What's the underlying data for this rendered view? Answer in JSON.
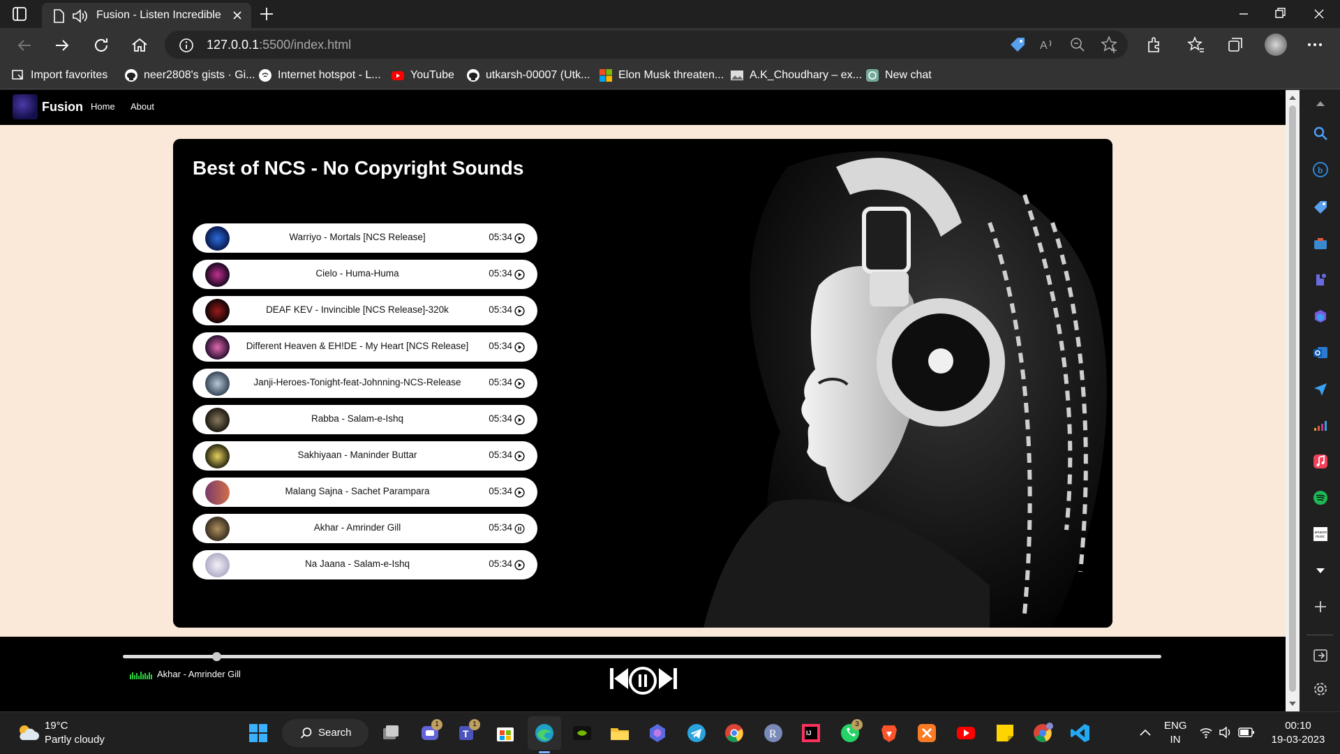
{
  "browser": {
    "tab": {
      "title": "Fusion - Listen Incredible"
    },
    "address": {
      "host": "127.0.0.1",
      "rest": ":5500/index.html"
    },
    "favorites": [
      {
        "label": "Import favorites",
        "icon": "import-icon"
      },
      {
        "label": "neer2808's gists · Gi...",
        "icon": "github-icon"
      },
      {
        "label": "Internet hotspot - L...",
        "icon": "wifi-icon"
      },
      {
        "label": "YouTube",
        "icon": "youtube-icon"
      },
      {
        "label": "utkarsh-00007 (Utk...",
        "icon": "github-icon"
      },
      {
        "label": "Elon Musk threaten...",
        "icon": "microsoft-icon"
      },
      {
        "label": "A.K_Choudhary – ex...",
        "icon": "photo-icon"
      },
      {
        "label": "New chat",
        "icon": "chatgpt-icon"
      }
    ]
  },
  "site": {
    "brand": "Fusion",
    "nav": {
      "home": "Home",
      "about": "About"
    },
    "heading": "Best of NCS - No Copyright Sounds",
    "songs": [
      {
        "name": "Warriyo - Mortals [NCS Release]",
        "duration": "05:34",
        "state": "play"
      },
      {
        "name": "Cielo - Huma-Huma",
        "duration": "05:34",
        "state": "play"
      },
      {
        "name": "DEAF KEV - Invincible [NCS Release]-320k",
        "duration": "05:34",
        "state": "play"
      },
      {
        "name": "Different Heaven & EH!DE - My Heart [NCS Release]",
        "duration": "05:34",
        "state": "play"
      },
      {
        "name": "Janji-Heroes-Tonight-feat-Johnning-NCS-Release",
        "duration": "05:34",
        "state": "play"
      },
      {
        "name": "Rabba - Salam-e-Ishq",
        "duration": "05:34",
        "state": "play"
      },
      {
        "name": "Sakhiyaan - Maninder Buttar",
        "duration": "05:34",
        "state": "play"
      },
      {
        "name": "Malang Sajna - Sachet Parampara",
        "duration": "05:34",
        "state": "play"
      },
      {
        "name": "Akhar - Amrinder Gill",
        "duration": "05:34",
        "state": "pause"
      },
      {
        "name": "Na Jaana - Salam-e-Ishq",
        "duration": "05:34",
        "state": "play"
      }
    ],
    "player": {
      "now_playing": "Akhar - Amrinder Gill",
      "progress": 0.09
    }
  },
  "taskbar": {
    "weather": {
      "temp": "19°C",
      "desc": "Partly cloudy"
    },
    "search_label": "Search",
    "badges": {
      "teams": "1",
      "teams2": "1",
      "whatsapp": "3"
    },
    "lang": {
      "line1": "ENG",
      "line2": "IN"
    },
    "clock": {
      "time": "00:10",
      "date": "19-03-2023"
    }
  },
  "colors": {
    "page_bg": "#fae9d9",
    "accent": "#000000"
  }
}
